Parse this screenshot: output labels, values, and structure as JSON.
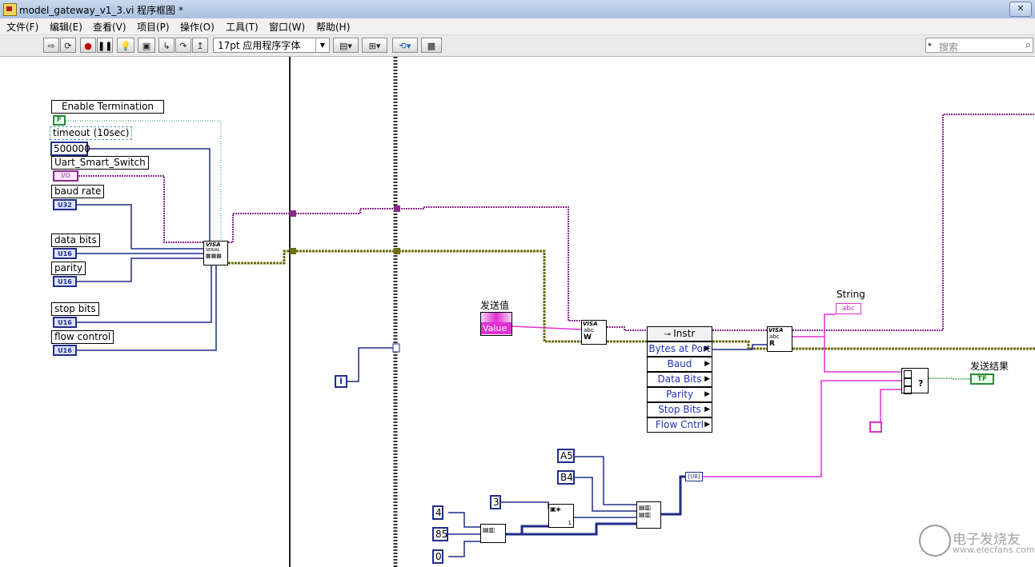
{
  "window": {
    "title": "model_gateway_v1_3.vi 程序框图 *",
    "close_label": "✕"
  },
  "menu": [
    "文件(F)",
    "编辑(E)",
    "查看(V)",
    "项目(P)",
    "操作(O)",
    "工具(T)",
    "窗口(W)",
    "帮助(H)"
  ],
  "toolbar": {
    "font_select": "17pt 应用程序字体",
    "search_placeholder": "搜索"
  },
  "diagram": {
    "left_labels": {
      "enable_termination": "Enable Termination",
      "timeout": "timeout (10sec)",
      "timeout_value": "500000",
      "uart": "Uart_Smart_Switch",
      "uart_const": "I/O",
      "baud_rate": "baud rate",
      "baud_type": "U32",
      "data_bits": "data bits",
      "parity": "parity",
      "stop_bits": "stop bits",
      "flow_control": "flow control",
      "u16": "U16",
      "bool_f": "F"
    },
    "loop_index": "i",
    "send_value_label": "发送值",
    "send_value": "Value",
    "property_node": [
      "Instr",
      "Bytes at Port",
      "Baud",
      "Data Bits",
      "Parity",
      "Stop Bits",
      "Flow Cntrl"
    ],
    "string_label": "String",
    "string_type": "abc",
    "result_label": "发送结果",
    "result_type": "TF",
    "consts": {
      "a5": "A5",
      "b4": "B4",
      "three": "3",
      "four": "4",
      "eighty_five": "85",
      "zero": "0",
      "one": "1"
    },
    "visa_label": "VISA",
    "serial_label": "SERIAL",
    "write_letter": "W",
    "read_letter": "R"
  },
  "watermark": {
    "line1": "电子发烧友",
    "line2": "www.elecfans.com"
  },
  "colors": {
    "refnum_wire": "#8a2a8a",
    "error_wire": "#6c6c12",
    "string_wire": "#e030d0",
    "numeric_wire": "#1f2d8a"
  }
}
